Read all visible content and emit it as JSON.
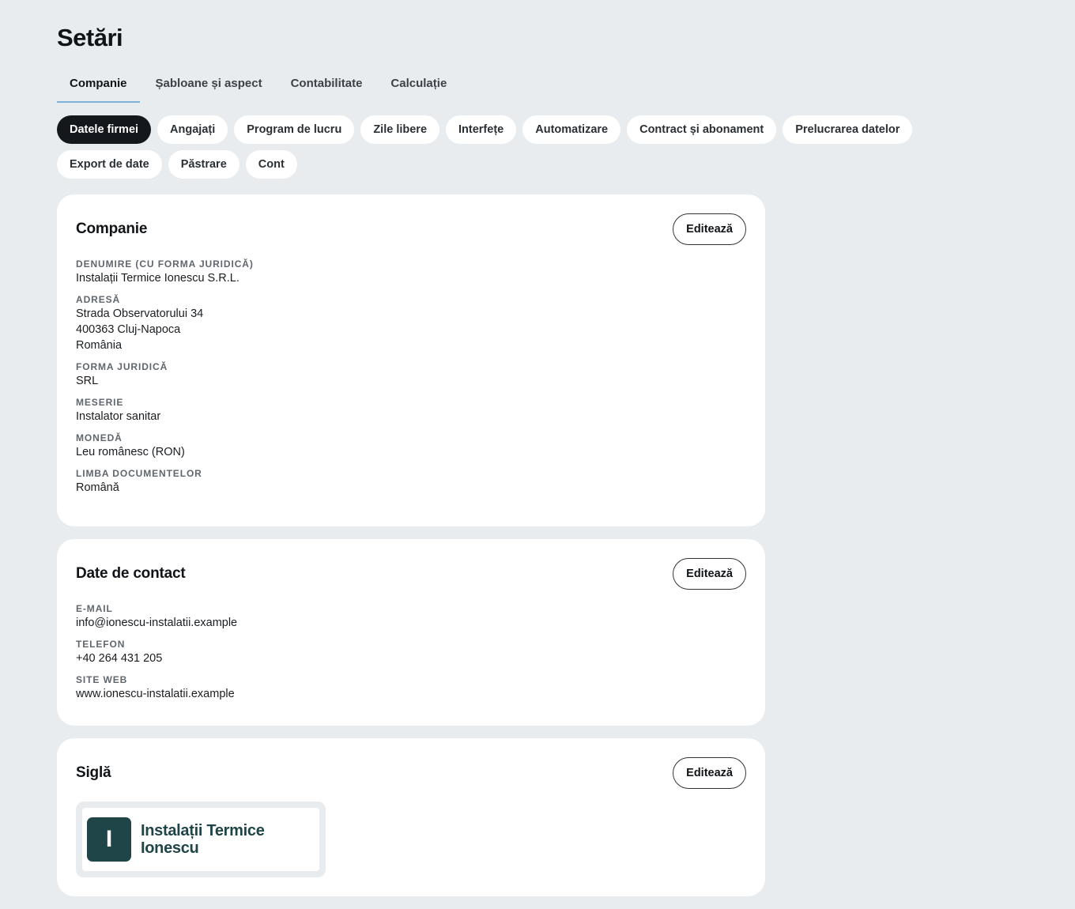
{
  "page": {
    "title": "Setări"
  },
  "tabs": [
    {
      "label": "Companie",
      "active": true
    },
    {
      "label": "Șabloane și aspect",
      "active": false
    },
    {
      "label": "Contabilitate",
      "active": false
    },
    {
      "label": "Calculație",
      "active": false
    }
  ],
  "subnav": [
    {
      "label": "Datele firmei",
      "active": true
    },
    {
      "label": "Angajați",
      "active": false
    },
    {
      "label": "Program de lucru",
      "active": false
    },
    {
      "label": "Zile libere",
      "active": false
    },
    {
      "label": "Interfețe",
      "active": false
    },
    {
      "label": "Automatizare",
      "active": false
    },
    {
      "label": "Contract și abonament",
      "active": false
    },
    {
      "label": "Prelucrarea datelor",
      "active": false
    },
    {
      "label": "Export de date",
      "active": false
    },
    {
      "label": "Păstrare",
      "active": false
    },
    {
      "label": "Cont",
      "active": false
    }
  ],
  "company_card": {
    "title": "Companie",
    "edit_label": "Editează",
    "fields": {
      "name_label": "Denumire (cu forma juridică)",
      "name_value": "Instalații Termice Ionescu S.R.L.",
      "address_label": "Adresă",
      "address_line1": "Strada Observatorului 34",
      "address_line2": "400363 Cluj-Napoca",
      "address_line3": "România",
      "legal_form_label": "Forma juridică",
      "legal_form_value": "SRL",
      "trade_label": "Meserie",
      "trade_value": "Instalator sanitar",
      "currency_label": "Monedă",
      "currency_value": "Leu românesc (RON)",
      "doc_language_label": "Limba documentelor",
      "doc_language_value": "Română"
    }
  },
  "contact_card": {
    "title": "Date de contact",
    "edit_label": "Editează",
    "fields": {
      "email_label": "E-mail",
      "email_value": "info@ionescu-instalatii.example",
      "phone_label": "Telefon",
      "phone_value": "+40 264 431 205",
      "website_label": "Site web",
      "website_value": "www.ionescu-instalatii.example"
    }
  },
  "logo_card": {
    "title": "Siglă",
    "edit_label": "Editează",
    "logo": {
      "mark_letter": "I",
      "text_line1": "Instalații Termice",
      "text_line2": "Ionescu",
      "color": "#1f4548"
    }
  },
  "colors": {
    "background": "#e8ecef",
    "card": "#ffffff",
    "active_pill": "#14181c",
    "tab_underline": "#7fb0d6"
  }
}
